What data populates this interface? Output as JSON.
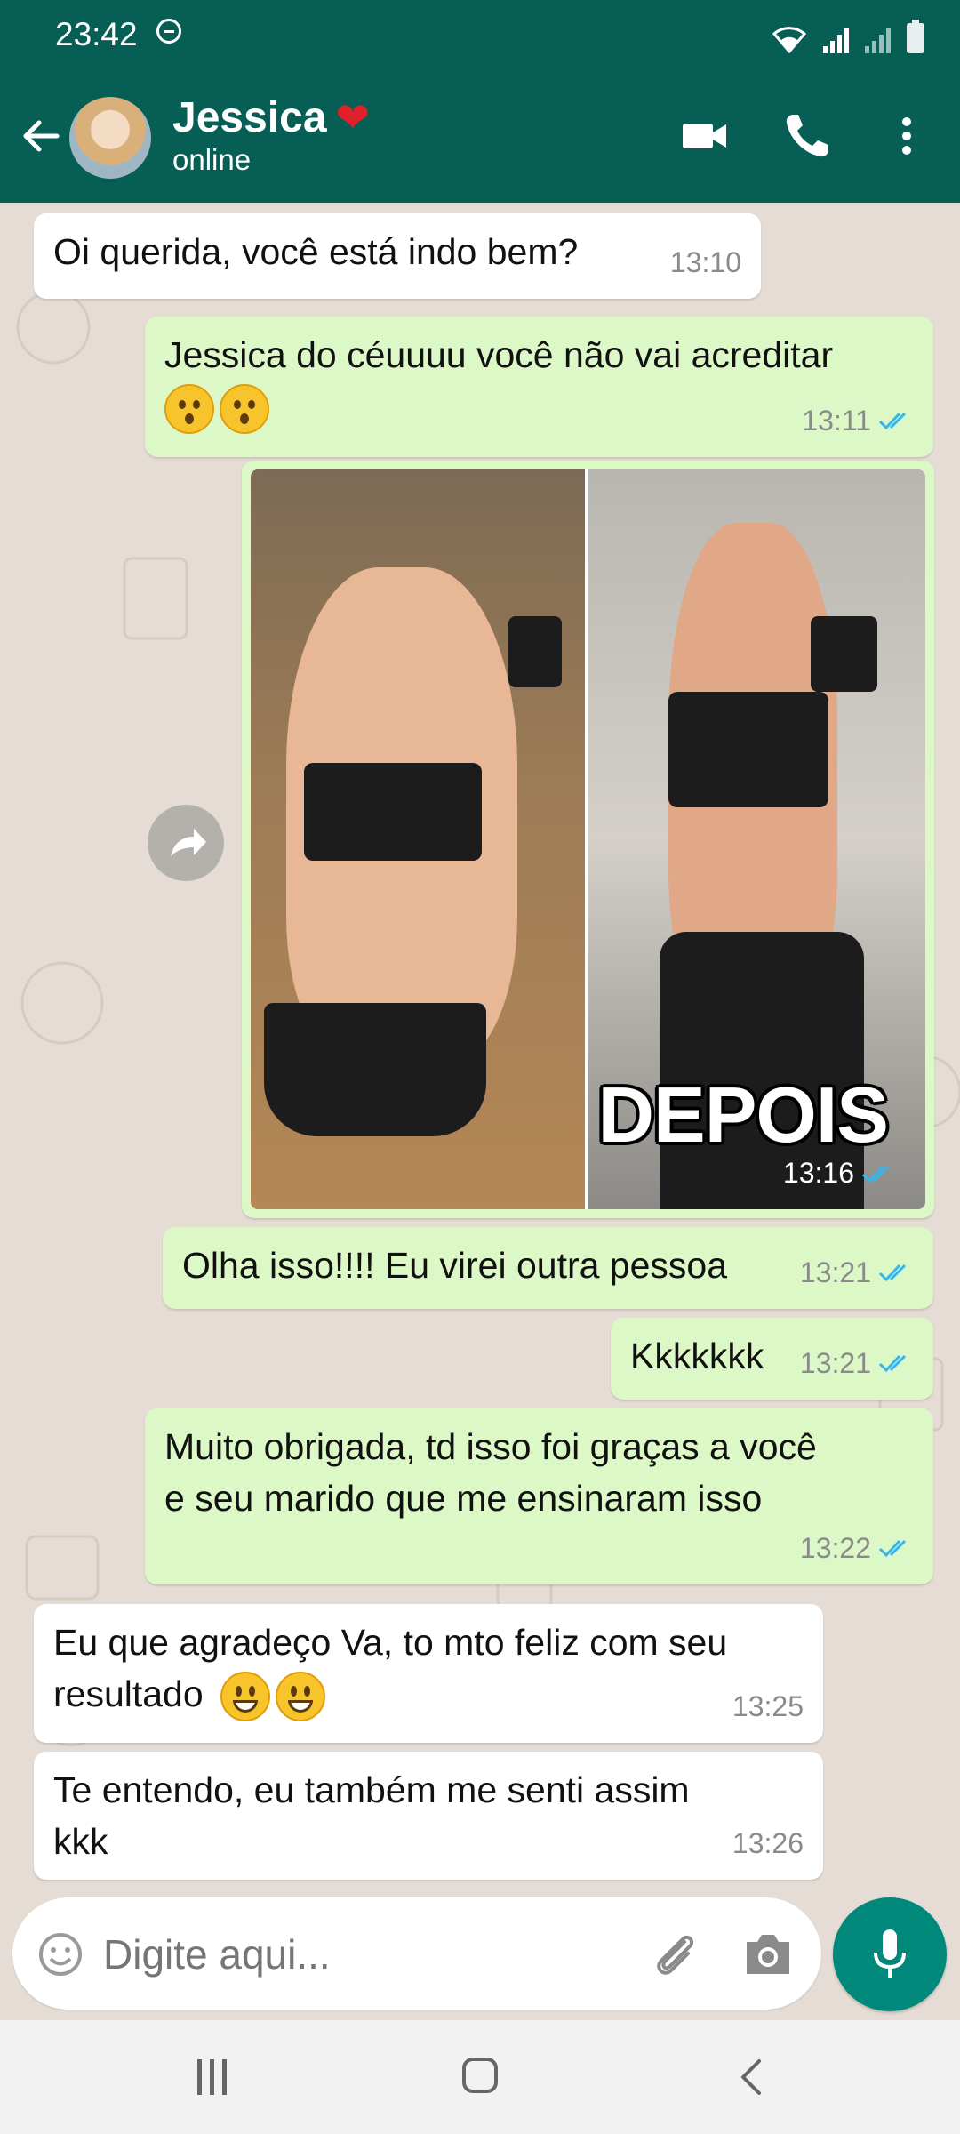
{
  "statusbar": {
    "time": "23:42"
  },
  "header": {
    "contact_name": "Jessica",
    "heart": "❤",
    "status": "online"
  },
  "messages": [
    {
      "direction": "in",
      "text": "Oi querida, você está indo bem?",
      "time": "13:10"
    },
    {
      "direction": "out",
      "text": "Jessica do céuuuu você não vai acreditar",
      "time": "13:11",
      "status": "read"
    },
    {
      "direction": "out",
      "type": "image",
      "caption_in_image": "DEPOIS",
      "time": "13:16",
      "status": "read"
    },
    {
      "direction": "out",
      "text": "Olha isso!!!! Eu virei outra pessoa",
      "time": "13:21",
      "status": "read"
    },
    {
      "direction": "out",
      "text": "Kkkkkkk",
      "time": "13:21",
      "status": "read"
    },
    {
      "direction": "out",
      "text_line1": "Muito obrigada, td isso foi graças a você",
      "text_line2": "e seu marido que me ensinaram isso",
      "time": "13:22",
      "status": "read"
    },
    {
      "direction": "in",
      "text_line1": "Eu que agradeço Va, to mto feliz com seu",
      "text_line2": "resultado",
      "time": "13:25"
    },
    {
      "direction": "in",
      "text_line1": "Te entendo, eu também me senti assim",
      "text_line2": "kkk",
      "time": "13:26"
    }
  ],
  "input": {
    "placeholder": "Digite aqui..."
  },
  "colors": {
    "header": "#075e54",
    "outgoing": "#dcf8c6",
    "incoming": "#ffffff",
    "accent": "#00897b",
    "read_ticks": "#34b7f1"
  },
  "icons": [
    "back-arrow-icon",
    "video-call-icon",
    "phone-icon",
    "more-vert-icon",
    "share-icon",
    "emoji-icon",
    "attach-icon",
    "camera-icon",
    "mic-icon"
  ]
}
